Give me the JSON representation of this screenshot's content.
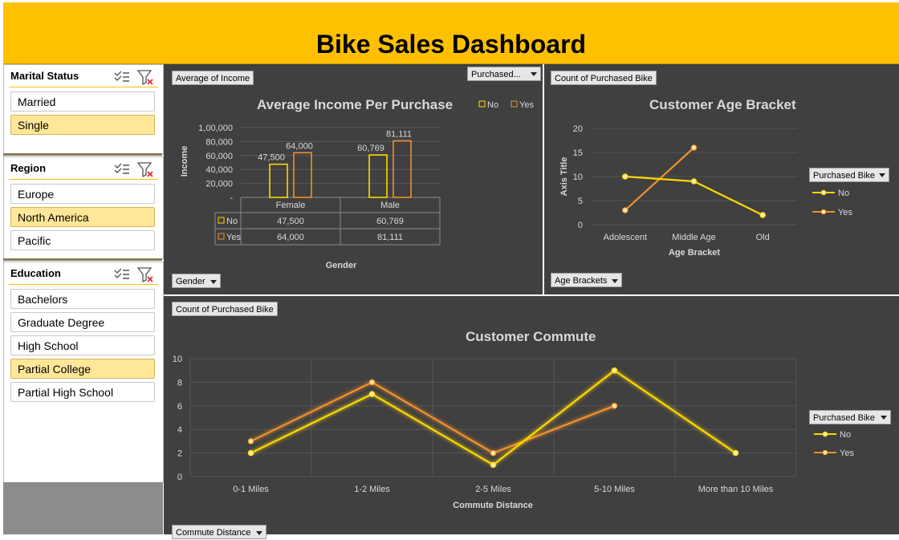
{
  "dashboard": {
    "title": "Bike Sales Dashboard"
  },
  "colors": {
    "no": "#FFD700",
    "yes": "#F0902A",
    "accent": "#FFC000",
    "panel": "#404040",
    "selected": "#FFE699"
  },
  "slicers": [
    {
      "title": "Marital Status",
      "items": [
        {
          "label": "Married",
          "selected": false
        },
        {
          "label": "Single",
          "selected": true
        }
      ]
    },
    {
      "title": "Region",
      "items": [
        {
          "label": "Europe",
          "selected": false
        },
        {
          "label": "North America",
          "selected": true
        },
        {
          "label": "Pacific",
          "selected": false
        }
      ]
    },
    {
      "title": "Education",
      "items": [
        {
          "label": "Bachelors",
          "selected": false
        },
        {
          "label": "Graduate Degree",
          "selected": false
        },
        {
          "label": "High School",
          "selected": false
        },
        {
          "label": "Partial College",
          "selected": true
        },
        {
          "label": "Partial High School",
          "selected": false
        }
      ]
    }
  ],
  "slicer_icons": [
    "multi-select-icon",
    "clear-filter-icon"
  ],
  "income_panel": {
    "value_chip": "Average of Income",
    "filter_chip": "Purchased...",
    "axis_chip": "Gender",
    "legend_no": "No",
    "legend_yes": "Yes",
    "table_row_no": "No",
    "table_row_yes": "Yes",
    "yticks": [
      "1,00,000",
      "80,000",
      "60,000",
      "40,000",
      "20,000",
      "-"
    ],
    "data_labels": {
      "female_no": "47,500",
      "female_yes": "64,000",
      "male_no": "60,769",
      "male_yes": "81,111"
    }
  },
  "age_panel": {
    "value_chip": "Count of Purchased Bike",
    "axis_chip": "Age Brackets",
    "legend_title": "Purchased Bike",
    "legend_no": "No",
    "legend_yes": "Yes"
  },
  "commute_panel": {
    "value_chip": "Count of Purchased Bike",
    "axis_chip": "Commute Distance",
    "legend_title": "Purchased Bike",
    "legend_no": "No",
    "legend_yes": "Yes"
  },
  "chart_data": [
    {
      "type": "bar",
      "title": "Average Income Per Purchase",
      "xlabel": "Gender",
      "ylabel": "Income",
      "categories": [
        "Female",
        "Male"
      ],
      "ylim": [
        0,
        100000
      ],
      "series": [
        {
          "name": "No",
          "values": [
            47500,
            60769
          ]
        },
        {
          "name": "Yes",
          "values": [
            64000,
            81111
          ]
        }
      ],
      "legend": "top-right",
      "grid": true
    },
    {
      "type": "line",
      "title": "Customer Age Bracket",
      "xlabel": "Age Bracket",
      "ylabel": "Axis Title",
      "categories": [
        "Adolescent",
        "Middle Age",
        "Old"
      ],
      "ylim": [
        0,
        20
      ],
      "yticks": [
        0,
        5,
        10,
        15,
        20
      ],
      "series": [
        {
          "name": "No",
          "values": [
            10,
            9,
            2
          ]
        },
        {
          "name": "Yes",
          "values": [
            3,
            16,
            null
          ]
        }
      ],
      "legend": "right",
      "grid": true
    },
    {
      "type": "line",
      "title": "Customer Commute",
      "xlabel": "Commute Distance",
      "ylabel": "",
      "categories": [
        "0-1 Miles",
        "1-2 Miles",
        "2-5 Miles",
        "5-10 Miles",
        "More than 10 Miles"
      ],
      "ylim": [
        0,
        10
      ],
      "yticks": [
        0,
        2,
        4,
        6,
        8,
        10
      ],
      "series": [
        {
          "name": "No",
          "values": [
            2,
            7,
            1,
            9,
            2
          ]
        },
        {
          "name": "Yes",
          "values": [
            3,
            8,
            2,
            6,
            null
          ]
        }
      ],
      "legend": "right",
      "grid": true
    }
  ]
}
